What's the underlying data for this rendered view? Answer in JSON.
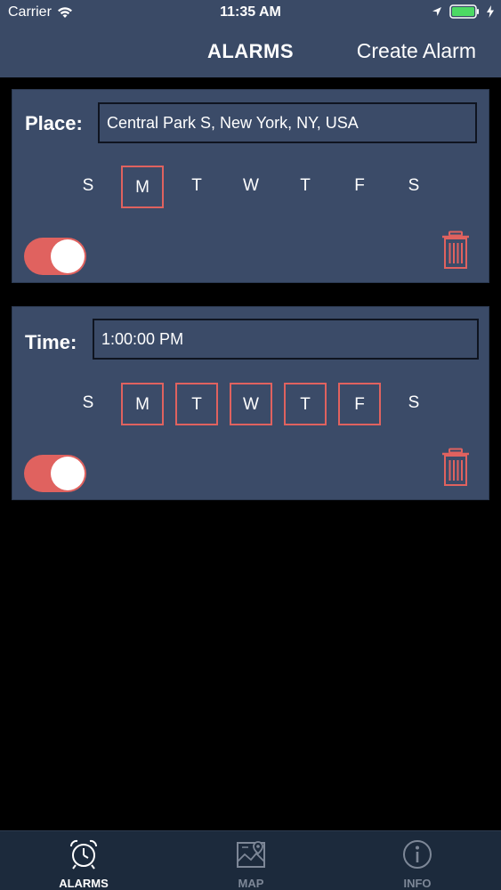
{
  "status": {
    "carrier": "Carrier",
    "time": "11:35 AM",
    "icons": [
      "wifi-icon",
      "location-arrow-icon",
      "battery-icon",
      "charging-bolt-icon"
    ]
  },
  "nav": {
    "title": "ALARMS",
    "action": "Create Alarm"
  },
  "alarms": [
    {
      "label": "Place:",
      "value": "Central Park S, New York, NY, USA",
      "days": [
        {
          "letter": "S",
          "selected": false
        },
        {
          "letter": "M",
          "selected": true
        },
        {
          "letter": "T",
          "selected": false
        },
        {
          "letter": "W",
          "selected": false
        },
        {
          "letter": "T",
          "selected": false
        },
        {
          "letter": "F",
          "selected": false
        },
        {
          "letter": "S",
          "selected": false
        }
      ],
      "enabled": true
    },
    {
      "label": "Time:",
      "value": "1:00:00 PM",
      "days": [
        {
          "letter": "S",
          "selected": false
        },
        {
          "letter": "M",
          "selected": true
        },
        {
          "letter": "T",
          "selected": true
        },
        {
          "letter": "W",
          "selected": true
        },
        {
          "letter": "T",
          "selected": true
        },
        {
          "letter": "F",
          "selected": true
        },
        {
          "letter": "S",
          "selected": false
        }
      ],
      "enabled": true
    }
  ],
  "tabs": [
    {
      "label": "ALARMS",
      "icon": "alarm-clock-icon",
      "active": true
    },
    {
      "label": "MAP",
      "icon": "map-icon",
      "active": false
    },
    {
      "label": "INFO",
      "icon": "info-icon",
      "active": false
    }
  ],
  "colors": {
    "accent": "#e0625f",
    "card": "#3b4b68",
    "nav": "#3a4a66",
    "tabbar": "#1c2a3c"
  }
}
